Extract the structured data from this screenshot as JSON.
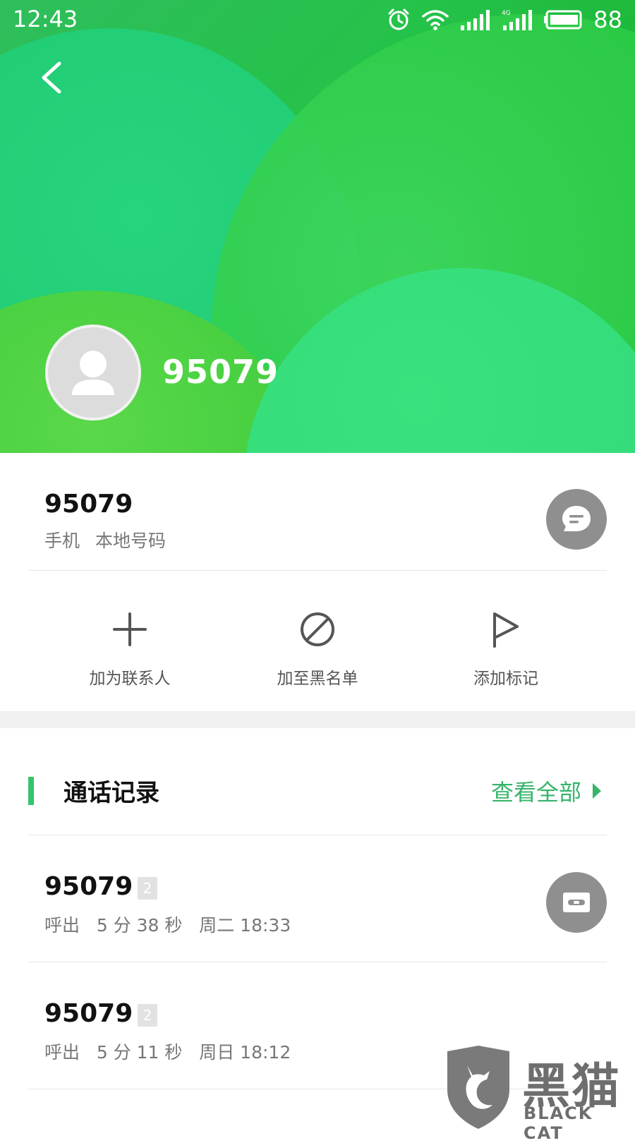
{
  "status_bar": {
    "time": "12:43",
    "battery_percent": "88",
    "icons": [
      "alarm-icon",
      "wifi-icon",
      "signal-icon",
      "signal-4g-icon",
      "battery-icon"
    ]
  },
  "header": {
    "back_icon": "chevron-left-icon",
    "number": "95079"
  },
  "number_card": {
    "number": "95079",
    "type": "手机",
    "location": "本地号码",
    "message_icon": "message-icon"
  },
  "actions": [
    {
      "label": "加为联系人",
      "icon": "plus-icon"
    },
    {
      "label": "加至黑名单",
      "icon": "block-icon"
    },
    {
      "label": "添加标记",
      "icon": "flag-icon"
    }
  ],
  "call_log": {
    "title": "通话记录",
    "view_all": "查看全部",
    "entries": [
      {
        "number": "95079",
        "sim": "2",
        "detail": "呼出   5 分 38 秒   周二 18:33",
        "has_recording": true
      },
      {
        "number": "95079",
        "sim": "2",
        "detail": "呼出   5 分 11 秒   周日 18:12",
        "has_recording": false
      }
    ]
  },
  "watermark": {
    "cn": "黑猫",
    "en": "BLACK CAT"
  },
  "colors": {
    "accent_green": "#35c46b",
    "link_green": "#35b46a",
    "header_green": "#2fc23c",
    "button_gray": "#8f8f8f"
  }
}
